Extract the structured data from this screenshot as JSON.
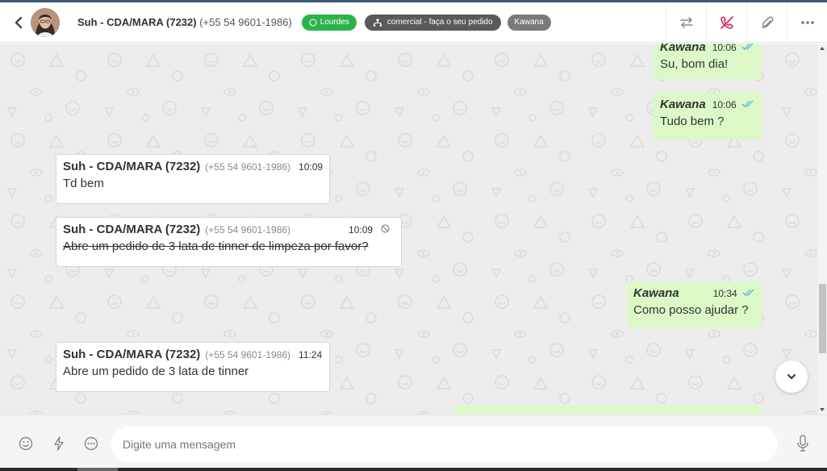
{
  "header": {
    "contact_name": "Suh - CDA/MARA (7232)",
    "contact_phone": "(+55 54 9601-1986)",
    "tags": {
      "whatsapp": "Lourdes",
      "department": "comercial - faça o seu pedido",
      "agent": "Kawana"
    }
  },
  "messages": [
    {
      "sender": "Kawana",
      "time": "10:06",
      "text": "Su, bom dia!"
    },
    {
      "sender": "Kawana",
      "time": "10:06",
      "text": "Tudo bem ?"
    },
    {
      "sender": "Suh - CDA/MARA (7232)",
      "phone": "(+55 54 9601-1986)",
      "time": "10:09",
      "text": "Td bem"
    },
    {
      "sender": "Suh - CDA/MARA (7232)",
      "phone": "(+55 54 9601-1986)",
      "time": "10:09",
      "text": "Abre um pedido de 3 lata de tinner de limpeza por favor?",
      "deleted": true
    },
    {
      "sender": "Kawana",
      "time": "10:34",
      "text": "Como posso ajudar ?"
    },
    {
      "sender": "Suh - CDA/MARA (7232)",
      "phone": "(+55 54 9601-1986)",
      "time": "11:24",
      "text": "Abre um pedido de 3 lata de tinner"
    }
  ],
  "composer": {
    "placeholder": "Digite uma mensagem"
  },
  "colors": {
    "outgoing_bubble": "#dcf8c6",
    "incoming_bubble": "#ffffff",
    "whatsapp_tag": "#2bb34a",
    "read_ticks": "#4fb3e8",
    "call_icon": "#d0245a"
  }
}
